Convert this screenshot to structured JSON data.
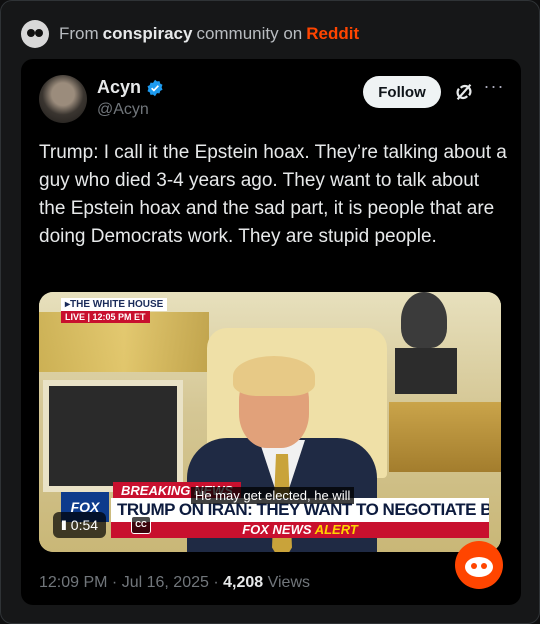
{
  "source": {
    "prefix": "From",
    "community": "conspiracy",
    "middle": "community on",
    "platform": "Reddit"
  },
  "tweet": {
    "author_name": "Acyn",
    "author_handle": "@Acyn",
    "follow_label": "Follow",
    "more_label": "···",
    "text": "Trump: I call it the Epstein hoax. They’re talking about a guy who died 3-4 years ago. They want to talk about the Epstein hoax and the sad part, it is people that are doing Democrats work. They are stupid people.",
    "timestamp": "12:09 PM · Jul 16, 2025 ·",
    "views_count": "4,208",
    "views_label": "Views"
  },
  "video": {
    "network_tag": "▸THE WHITE HOUSE",
    "live_tag": "LIVE  |  12:05 PM ET",
    "breaking_label": "BREAKING NEWS",
    "headline": "TRUMP ON IRAN: THEY WANT TO NEGOTIATE BADLY",
    "logo_text": "FOX",
    "alert_prefix": "FOX NEWS",
    "alert_word": "ALERT",
    "caption": "He may get elected, he will",
    "time_label": "0:54",
    "cc_label": "CC",
    "pause_label": "II"
  },
  "colors": {
    "reddit_orange": "#ff4500",
    "x_verified_blue": "#1d9bf0",
    "fox_red": "#c8102e"
  }
}
